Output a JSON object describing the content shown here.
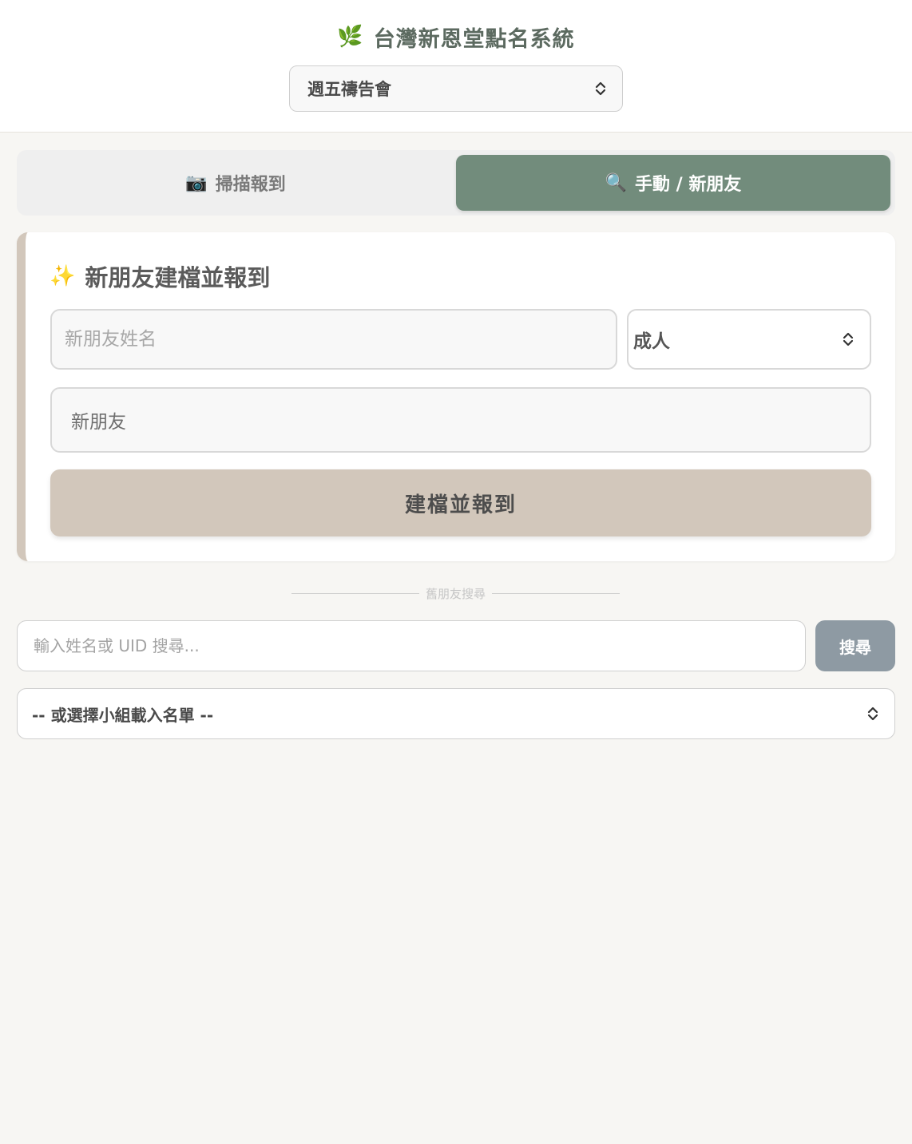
{
  "header": {
    "leaf_icon": "🌿",
    "title": "台灣新恩堂點名系統",
    "event_select": {
      "selected": "週五禱告會"
    }
  },
  "tabs": [
    {
      "icon": "📷",
      "label": "掃描報到",
      "active": false
    },
    {
      "icon": "🔍",
      "label": "手動 / 新朋友",
      "active": true
    }
  ],
  "new_friend_card": {
    "icon": "✨",
    "title": "新朋友建檔並報到",
    "name_placeholder": "新朋友姓名",
    "age_select": {
      "selected": "成人"
    },
    "group_value": "新朋友",
    "submit_label": "建檔並報到"
  },
  "divider": {
    "label": "舊朋友搜尋"
  },
  "search": {
    "placeholder": "輸入姓名或 UID 搜尋...",
    "button_label": "搜尋",
    "group_select": {
      "selected": "-- 或選擇小組載入名單 --"
    }
  },
  "colors": {
    "accent_green": "#728c7c",
    "beige": "#d2c7bb",
    "search_button": "#8e9aa3",
    "background": "#f7f6f3"
  }
}
